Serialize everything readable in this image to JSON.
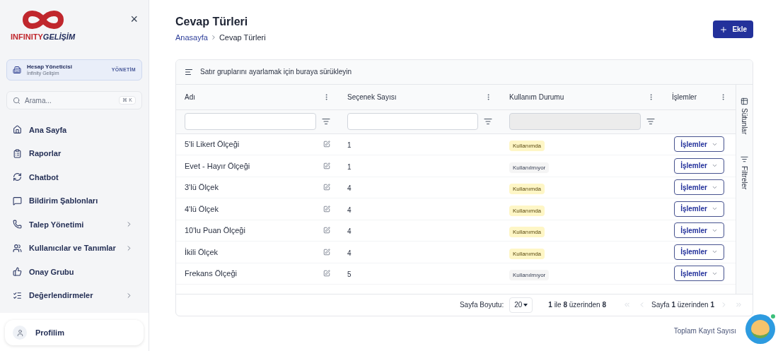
{
  "sidebar": {
    "logo": {
      "word1": "INFINITY",
      "word2": "GELİŞİM"
    },
    "close": "×",
    "account": {
      "title": "Hesap Yöneticisi",
      "subtitle": "İnfinity Gelişim",
      "badge": "YÖNETİM"
    },
    "search": {
      "placeholder": "Arama...",
      "shortcut": "⌘ K"
    },
    "items": [
      {
        "label": "Ana Sayfa",
        "expandable": false
      },
      {
        "label": "Raporlar",
        "expandable": false
      },
      {
        "label": "Chatbot",
        "expandable": false
      },
      {
        "label": "Bildirim Şablonları",
        "expandable": false
      },
      {
        "label": "Talep Yönetimi",
        "expandable": true
      },
      {
        "label": "Kullanıcılar ve Tanımlar",
        "expandable": true
      },
      {
        "label": "Onay Grubu",
        "expandable": false
      },
      {
        "label": "Değerlendirmeler",
        "expandable": true
      }
    ],
    "profile": {
      "label": "Profilim"
    }
  },
  "page": {
    "title": "Cevap Türleri",
    "breadcrumb": [
      "Anasayfa",
      "Cevap Türleri"
    ],
    "add_button": "Ekle"
  },
  "table": {
    "group_hint": "Satır gruplarını ayarlamak için buraya sürükleyin",
    "columns": [
      {
        "label": "Adı",
        "kind": "text"
      },
      {
        "label": "Seçenek Sayısı",
        "kind": "text"
      },
      {
        "label": "Kullanım Durumu",
        "kind": "disabled"
      },
      {
        "label": "İşlemler",
        "kind": "none"
      }
    ],
    "rows": [
      {
        "name": "5'li Likert Ölçeği",
        "count": "1",
        "status": "Kullanımda",
        "in_use": true,
        "action": "İşlemler"
      },
      {
        "name": "Evet - Hayır Ölçeği",
        "count": "1",
        "status": "Kullanılmıyor",
        "in_use": false,
        "action": "İşlemler"
      },
      {
        "name": "3'lü Ölçek",
        "count": "4",
        "status": "Kullanımda",
        "in_use": true,
        "action": "İşlemler"
      },
      {
        "name": "4'lü Ölçek",
        "count": "4",
        "status": "Kullanımda",
        "in_use": true,
        "action": "İşlemler"
      },
      {
        "name": "10'lu Puan Ölçeği",
        "count": "4",
        "status": "Kullanımda",
        "in_use": true,
        "action": "İşlemler"
      },
      {
        "name": "İkili Ölçek",
        "count": "4",
        "status": "Kullanımda",
        "in_use": true,
        "action": "İşlemler"
      },
      {
        "name": "Frekans Ölçeği",
        "count": "5",
        "status": "Kullanılmıyor",
        "in_use": false,
        "action": "İşlemler"
      }
    ],
    "side_tabs": [
      {
        "label": "Sütunlar"
      },
      {
        "label": "Filtreler"
      }
    ],
    "footer": {
      "page_size_label": "Sayfa Boyutu:",
      "page_size": "20",
      "range": "**1** ile **8** üzerinden **8**",
      "page": "Sayfa **1** üzerinden **1**"
    }
  },
  "total_label": "Toplam Kayıt Sayısı"
}
